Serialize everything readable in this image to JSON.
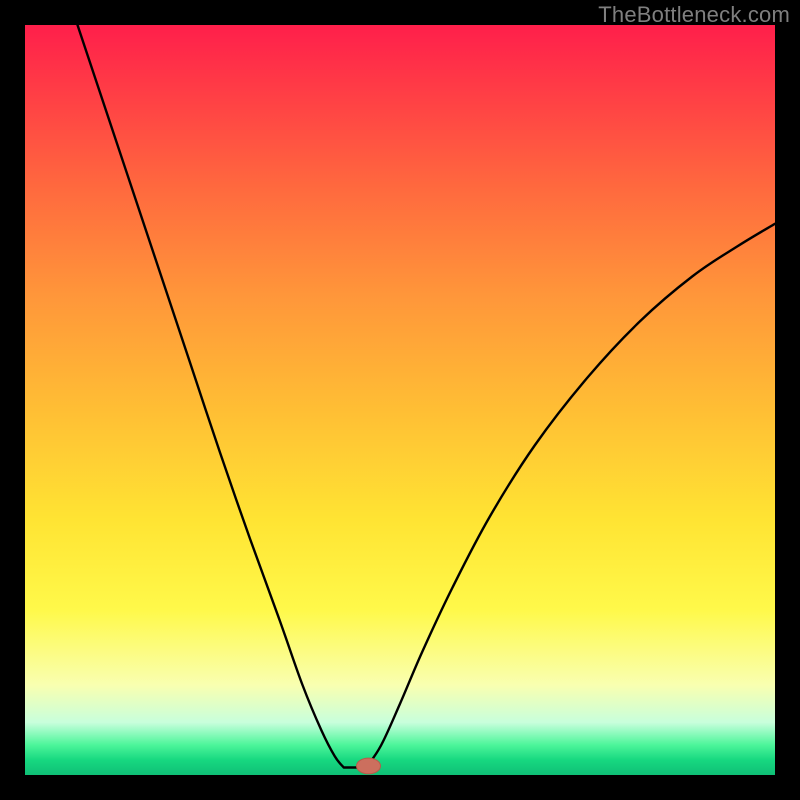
{
  "watermark": "TheBottleneck.com",
  "colors": {
    "frame": "#000000",
    "watermark": "#7f7f7f",
    "curve": "#000000",
    "marker_fill": "#cc6f5e",
    "marker_stroke": "#b85a4a"
  },
  "chart_data": {
    "type": "line",
    "title": "",
    "xlabel": "",
    "ylabel": "",
    "xlim": [
      0,
      100
    ],
    "ylim": [
      0,
      100
    ],
    "grid": false,
    "legend": false,
    "note": "Axes are implicit percentage scales (0–100). Values estimated from pixel positions on a 750×750 plot area.",
    "series": [
      {
        "name": "left-branch",
        "x": [
          7.0,
          10.0,
          14.0,
          18.0,
          22.0,
          26.0,
          30.0,
          34.0,
          37.0,
          39.5,
          41.3,
          42.5
        ],
        "y": [
          100.0,
          91.0,
          79.0,
          67.0,
          55.0,
          43.0,
          31.5,
          20.5,
          12.0,
          6.0,
          2.5,
          1.0
        ]
      },
      {
        "name": "valley-floor",
        "x": [
          42.5,
          45.5
        ],
        "y": [
          1.0,
          1.0
        ]
      },
      {
        "name": "right-branch",
        "x": [
          45.5,
          47.5,
          50.0,
          53.0,
          57.0,
          62.0,
          68.0,
          75.0,
          82.0,
          89.0,
          95.0,
          100.0
        ],
        "y": [
          1.0,
          4.0,
          9.5,
          16.5,
          25.0,
          34.5,
          44.0,
          53.0,
          60.5,
          66.5,
          70.5,
          73.5
        ]
      }
    ],
    "marker": {
      "x": 45.8,
      "y": 1.2,
      "rx": 1.6,
      "ry": 1.05
    }
  }
}
